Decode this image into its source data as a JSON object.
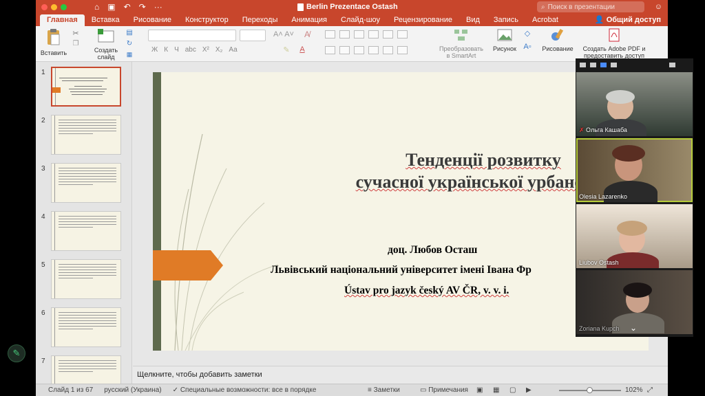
{
  "window": {
    "title": "Berlin Prezentace Ostash",
    "search_placeholder": "Поиск в презентации"
  },
  "tabs": [
    {
      "label": "Главная",
      "active": true
    },
    {
      "label": "Вставка"
    },
    {
      "label": "Рисование"
    },
    {
      "label": "Конструктор"
    },
    {
      "label": "Переходы"
    },
    {
      "label": "Анимация"
    },
    {
      "label": "Слайд-шоу"
    },
    {
      "label": "Рецензирование"
    },
    {
      "label": "Вид"
    },
    {
      "label": "Запись"
    },
    {
      "label": "Acrobat"
    }
  ],
  "share_label": "Общий доступ",
  "ribbon": {
    "paste": "Вставить",
    "new_slide_l1": "Создать",
    "new_slide_l2": "слайд",
    "smartart_l1": "Преобразовать",
    "smartart_l2": "в SmartArt",
    "picture": "Рисунок",
    "drawing": "Рисование",
    "pdf_l1": "Создать Adobe PDF и",
    "pdf_l2": "предоставить доступ",
    "fmt": [
      "Ж",
      "К",
      "Ч",
      "abc",
      "X²",
      "X₂",
      "Aa"
    ]
  },
  "thumbnails": [
    "1",
    "2",
    "3",
    "4",
    "5",
    "6",
    "7"
  ],
  "slide": {
    "title_line1": "Тенденції розвитку",
    "title_line2": "сучасної української урбанонім",
    "author": "доц. Любов Осташ",
    "university": "Львівський національний університет імені Івана Фр",
    "institute": "Ústav pro jazyk český AV ČR, v. v. i."
  },
  "notes_placeholder": "Щелкните, чтобы добавить заметки",
  "status": {
    "slide_counter": "Слайд 1 из 67",
    "language": "русский (Украина)",
    "accessibility": "Специальные возможности: все в порядке",
    "notes": "Заметки",
    "comments": "Примечания",
    "zoom": "102%"
  },
  "participants": [
    {
      "name": "Ольга Кашаба",
      "muted": true
    },
    {
      "name": "Olesia Lazarenko"
    },
    {
      "name": "Liubov Ostash"
    },
    {
      "name": "Zoriana Kupch"
    }
  ],
  "colors": {
    "accent": "#c8462c",
    "slide_bg": "#f6f4e6",
    "arrow": "#e07b26",
    "strip": "#5e6a4d"
  }
}
